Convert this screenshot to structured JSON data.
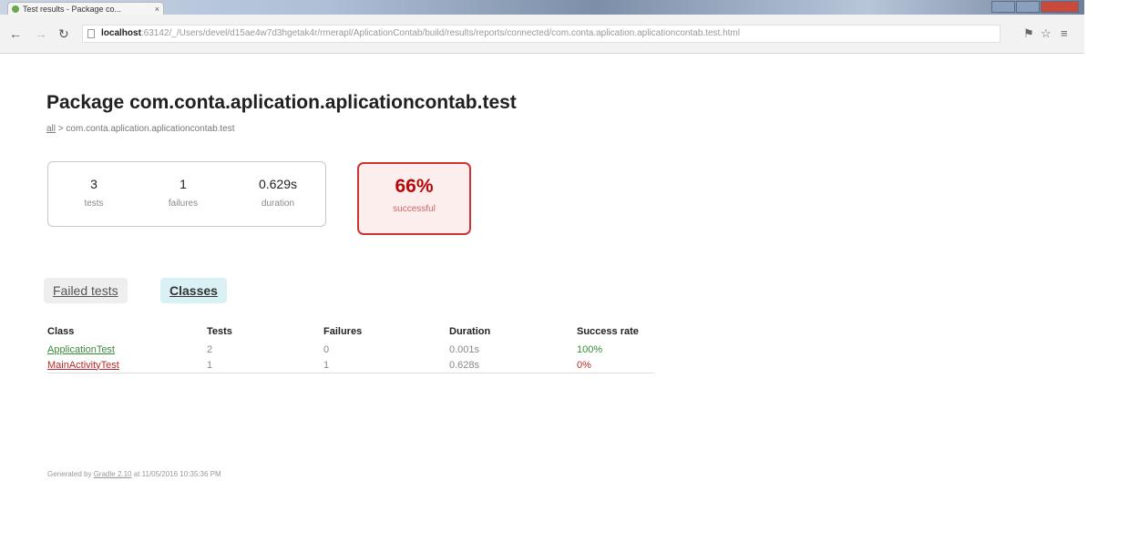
{
  "browser": {
    "tab_title": "Test results - Package co...",
    "tab_close": "×",
    "url_host": "localhost",
    "url_rest": ":63142/_/Users/devel/d15ae4w7d3hgetak4r/rmerapl/AplicationContab/build/results/reports/connected/com.conta.aplication.aplicationcontab.test.html",
    "icons": [
      "favicon-icon",
      "back-icon",
      "forward-icon",
      "reload-icon",
      "page-icon",
      "translate-icon",
      "star-icon",
      "menu-icon"
    ]
  },
  "report": {
    "title": "Package com.conta.aplication.aplicationcontab.test",
    "breadcrumb_all": "all",
    "breadcrumb_rest": " > com.conta.aplication.aplicationcontab.test",
    "summary": {
      "tests_value": "3",
      "tests_label": "tests",
      "failures_value": "1",
      "failures_label": "failures",
      "duration_value": "0.629s",
      "duration_label": "duration"
    },
    "success": {
      "percent": "66%",
      "label": "successful",
      "color": "#b60808"
    },
    "tabs": {
      "failed": "Failed tests",
      "classes": "Classes"
    },
    "table": {
      "headers": [
        "Class",
        "Tests",
        "Failures",
        "Duration",
        "Success rate"
      ],
      "rows": [
        {
          "class": "ApplicationTest",
          "tests": "2",
          "failures": "0",
          "duration": "0.001s",
          "rate": "100%",
          "status": "pass"
        },
        {
          "class": "MainActivityTest",
          "tests": "1",
          "failures": "1",
          "duration": "0.628s",
          "rate": "0%",
          "status": "fail"
        }
      ]
    },
    "footer": {
      "prefix": "Generated by ",
      "link": "Gradle 2.10",
      "suffix": " at 11/05/2016 10:35:36 PM"
    }
  }
}
